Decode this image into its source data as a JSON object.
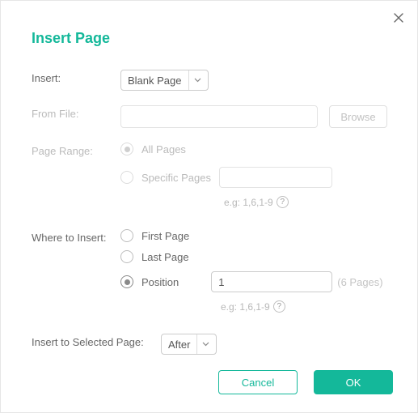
{
  "title": "Insert Page",
  "labels": {
    "insert": "Insert:",
    "from_file": "From File:",
    "page_range": "Page Range:",
    "where": "Where to Insert:",
    "insert_to_selected": "Insert to Selected Page:"
  },
  "insert_select": {
    "value": "Blank Page"
  },
  "from_file": {
    "value": "",
    "browse": "Browse"
  },
  "page_range": {
    "all": "All Pages",
    "specific": "Specific Pages",
    "value": "",
    "hint": "e.g: 1,6,1-9"
  },
  "where": {
    "first": "First Page",
    "last": "Last Page",
    "position": "Position",
    "position_value": "1",
    "pages_note": "(6 Pages)",
    "hint": "e.g: 1,6,1-9"
  },
  "selected_page_select": {
    "value": "After"
  },
  "buttons": {
    "cancel": "Cancel",
    "ok": "OK"
  }
}
